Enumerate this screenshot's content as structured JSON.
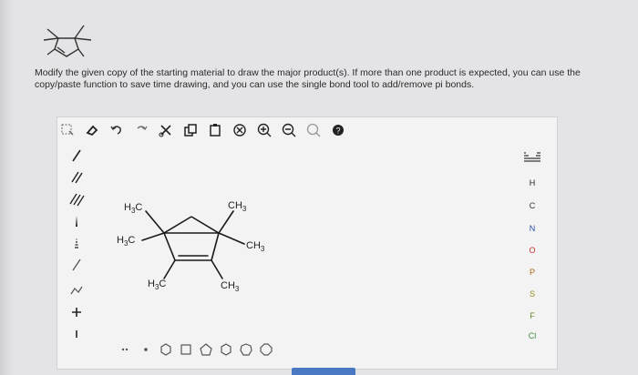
{
  "question": {
    "line1": "Modify the given copy of the starting material to draw the major product(s). If more than one product is expected, you can use the",
    "line2": "copy/paste function to save time drawing, and you can use the single bond tool to add/remove pi bonds."
  },
  "toolbar": {
    "items": [
      {
        "name": "select-lasso-icon",
        "glyph": "⬚"
      },
      {
        "name": "erase-icon",
        "glyph": "⌫"
      },
      {
        "name": "undo-icon",
        "glyph": "↶"
      },
      {
        "name": "redo-icon",
        "glyph": "↷"
      },
      {
        "name": "cut-icon",
        "glyph": "✂"
      },
      {
        "name": "copy-icon",
        "glyph": "⧉"
      },
      {
        "name": "paste-icon",
        "glyph": "⎘"
      },
      {
        "name": "zoom-fit-icon",
        "glyph": "⊗"
      },
      {
        "name": "zoom-in-icon",
        "glyph": "⊕"
      },
      {
        "name": "zoom-out-icon",
        "glyph": "⊖"
      },
      {
        "name": "clean-icon",
        "glyph": "◎"
      },
      {
        "name": "help-icon",
        "glyph": "?"
      }
    ]
  },
  "molecule_labels": {
    "h3c_top": "H",
    "h3c_top_sub": "3",
    "h3c_top_c": "C",
    "h3c_mid": "H",
    "h3c_mid_sub": "3",
    "h3c_mid_c": "C",
    "h3c_bot": "H",
    "h3c_bot_sub": "3",
    "h3c_bot_c": "C",
    "ch3_top": "CH",
    "ch3_top_sub": "3",
    "ch3_mid": "CH",
    "ch3_mid_sub": "3",
    "ch3_bot": "CH",
    "ch3_bot_sub": "3"
  },
  "elements": {
    "items": [
      "H",
      "C",
      "N",
      "O",
      "P",
      "S",
      "F",
      "Cl"
    ]
  },
  "colors": {
    "blue_accent": "#4a78c2",
    "red_o": "#c0392b",
    "help_dark": "#222222"
  }
}
